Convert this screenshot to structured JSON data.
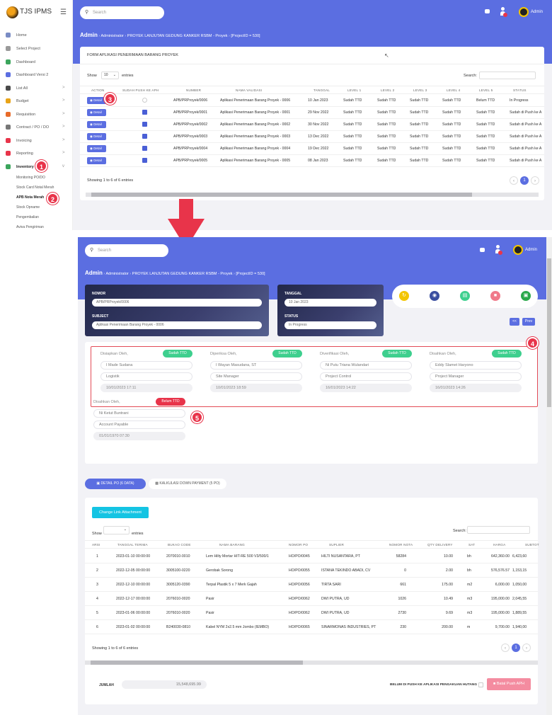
{
  "app": {
    "name": "TJS IPMS"
  },
  "sidebar": {
    "items": [
      {
        "label": "Home",
        "color": "#7a8cc4",
        "chev": ""
      },
      {
        "label": "Select Project",
        "color": "#9a9a9a",
        "chev": ""
      },
      {
        "label": "Dashboard",
        "color": "#3ba55c",
        "chev": ""
      },
      {
        "label": "Dashboard Versi 2",
        "color": "#5b6ee1",
        "chev": ""
      },
      {
        "label": "List All",
        "color": "#4a4a4a",
        "chev": ">"
      },
      {
        "label": "Budget",
        "color": "#e8a317",
        "chev": ">"
      },
      {
        "label": "Requisition",
        "color": "#e86b2a",
        "chev": ">"
      },
      {
        "label": "Contract / PO / DO",
        "color": "#777",
        "chev": ">"
      },
      {
        "label": "Invoicing",
        "color": "#e8344a",
        "chev": ">"
      },
      {
        "label": "Reporting",
        "color": "#e8344a",
        "chev": ">"
      },
      {
        "label": "Inventory",
        "color": "#3ba55c",
        "chev": "v"
      }
    ],
    "sub": [
      "Monitoring PO/DO",
      "Stock Card Notal Merah",
      "APB Nota Merah",
      "Stock Opname",
      "Pengembalian",
      "Aviva Pengiriman"
    ]
  },
  "header": {
    "search_placeholder": "Search",
    "user": "Admin"
  },
  "breadcrumb": {
    "title": "Admin",
    "items": [
      "Administrator",
      "PROYEK LANJUTAN GEDUNG KANKER RSBM - Proyek",
      "[ProjectID = 530]"
    ]
  },
  "list": {
    "title": "FORM APLIKASI PENERIMAAN BARANG PROYEK",
    "show_label": "Show",
    "show_value": "10",
    "entries_label": "entries",
    "search_label": "Search:",
    "columns": [
      "ACTION",
      "SUDAH PUSH KE APH",
      "NUMBER",
      "NAMA VALIDASI",
      "TANGGAL",
      "LEVEL 1",
      "LEVEL 2",
      "LEVEL 3",
      "LEVEL 4",
      "LEVEL 5",
      "STATUS"
    ],
    "detail_label": "Detail",
    "rows": [
      {
        "number": "APB/PRProyek/0006",
        "nama": "Aplikasi Penerimaan Barang Proyek - 0006",
        "tanggal": "10 Jan 2023",
        "l1": "Sudah TTD",
        "l2": "Sudah TTD",
        "l3": "Sudah TTD",
        "l4": "Sudah TTD",
        "l5": "Belum TTD",
        "status": "In Progress",
        "pushed": false
      },
      {
        "number": "APB/PRProyek/0001",
        "nama": "Aplikasi Penerimaan Barang Proyek - 0001",
        "tanggal": "29 Nov 2022",
        "l1": "Sudah TTD",
        "l2": "Sudah TTD",
        "l3": "Sudah TTD",
        "l4": "Sudah TTD",
        "l5": "Sudah TTD",
        "status": "Sudah di Push ke A",
        "pushed": true
      },
      {
        "number": "APB/PRProyek/0002",
        "nama": "Aplikasi Penerimaan Barang Proyek - 0002",
        "tanggal": "30 Nov 2022",
        "l1": "Sudah TTD",
        "l2": "Sudah TTD",
        "l3": "Sudah TTD",
        "l4": "Sudah TTD",
        "l5": "Sudah TTD",
        "status": "Sudah di Push ke A",
        "pushed": true
      },
      {
        "number": "APB/PRProyek/0003",
        "nama": "Aplikasi Penerimaan Barang Proyek - 0003",
        "tanggal": "13 Dec 2022",
        "l1": "Sudah TTD",
        "l2": "Sudah TTD",
        "l3": "Sudah TTD",
        "l4": "Sudah TTD",
        "l5": "Sudah TTD",
        "status": "Sudah di Push ke A",
        "pushed": true
      },
      {
        "number": "APB/PRProyek/0004",
        "nama": "Aplikasi Penerimaan Barang Proyek - 0004",
        "tanggal": "19 Dec 2022",
        "l1": "Sudah TTD",
        "l2": "Sudah TTD",
        "l3": "Sudah TTD",
        "l4": "Sudah TTD",
        "l5": "Sudah TTD",
        "status": "Sudah di Push ke A",
        "pushed": true
      },
      {
        "number": "APB/PRProyek/0005",
        "nama": "Aplikasi Penerimaan Barang Proyek - 0005",
        "tanggal": "08 Jan 2023",
        "l1": "Sudah TTD",
        "l2": "Sudah TTD",
        "l3": "Sudah TTD",
        "l4": "Sudah TTD",
        "l5": "Sudah TTD",
        "status": "Sudah di Push ke A",
        "pushed": true
      }
    ],
    "showing": "Showing 1 to 6 of 6 entries",
    "page": "1"
  },
  "detail": {
    "nomor_label": "NOMOR",
    "nomor": "APB/PRProyek/0006",
    "subject_label": "SUBJECT",
    "subject": "Aplikasi Penerimaan Barang Proyek - 0006",
    "tanggal_label": "TANGGAL",
    "tanggal": "10 Jan 2023",
    "status_label": "STATUS",
    "status": "In Progress",
    "back_label": "<<",
    "prev_label": "Prev",
    "signers": [
      {
        "role": "Disiapkan Oleh,",
        "badge": "Sudah TTD",
        "name": "I Made Sudana",
        "jabatan": "Logistik",
        "date": "10/01/2023 17:11"
      },
      {
        "role": "Diperiksa Oleh,",
        "badge": "Sudah TTD",
        "name": "I Wayan Masudana, ST",
        "jabatan": "Site Manager",
        "date": "10/01/2023 18:59"
      },
      {
        "role": "Diverifikasi Oleh,",
        "badge": "Sudah TTD",
        "name": "Ni Putu Triana Wulandari",
        "jabatan": "Project Control",
        "date": "16/01/2023 14:22"
      },
      {
        "role": "Disahkan Oleh,",
        "badge": "Sudah TTD",
        "name": "Eddy Slamet Haryono",
        "jabatan": "Project Manager",
        "date": "16/01/2023 14:26"
      },
      {
        "role": "Disahkan Oleh,",
        "badge": "Belum TTD",
        "name": "Ni Ketut Buntrani",
        "jabatan": "Account Payable",
        "date": "01/01/1970 07:30"
      }
    ],
    "tab1": "DETAIL PO (6 DATA)",
    "tab2": "KALKULASI DOWN PAYMENT (5 PO)",
    "change_btn": "Change Link Attachment",
    "show_label": "Show",
    "entries_label": "entries",
    "search_label": "Search:",
    "columns": [
      "ARSI",
      "TANGGAL TERIMA",
      "BUKAO CODE",
      "NAMA BARANG",
      "NOMOR PO",
      "SUPLIER",
      "NOMOR NOTA",
      "QTY DELIVERY",
      "SAT",
      "HARGA",
      "SUBTOT"
    ],
    "rows": [
      [
        "1",
        "2023-01-10 00:00:00",
        "2070010-0010",
        "Lem Hilty Mortar HIT-RE 500 V3/500/1",
        "HO/PO/0045",
        "HILTI NUSANTARA, PT",
        "58284",
        "10.00",
        "bh",
        "642,360.00",
        "6,423,60"
      ],
      [
        "2",
        "2022-12-05 00:00:00",
        "3005100-0220",
        "Gerobak Sorong",
        "HO/PO/0055",
        "ISTANA TEKINDO ABADI, CV",
        "0",
        "2.00",
        "bh",
        "576,576.57",
        "1,153,15"
      ],
      [
        "3",
        "2022-12-10 00:00:00",
        "3005120-0390",
        "Terpal Plastik 5 x 7 Merk Gajah",
        "HO/PO/0056",
        "TIRTA SARI",
        "661",
        "175.00",
        "m2",
        "6,000.00",
        "1,050,00"
      ],
      [
        "4",
        "2022-12-17 00:00:00",
        "2076010-0020",
        "Pasir",
        "HO/PO/0062",
        "DWI PUTRA, UD",
        "1026",
        "10.49",
        "m3",
        "195,000.00",
        "2,045,55"
      ],
      [
        "5",
        "2023-01-06 00:00:00",
        "2076010-0020",
        "Pasir",
        "HO/PO/0062",
        "DWI PUTRA, UD",
        "2730",
        "9.69",
        "m3",
        "195,000.00",
        "1,889,55"
      ],
      [
        "6",
        "2023-01-02 00:00:00",
        "B240030-0810",
        "Kabel NYM 2x2.5 mm Jombo (IEMBO)",
        "HO/PO/0065",
        "SINARMONAS INDUSTRIES, PT",
        "230",
        "200.00",
        "m",
        "9,700.00",
        "1,940,00"
      ]
    ],
    "showing": "Showing 1 to 6 of 6 entries",
    "page": "1",
    "jumlah_label": "JUMLAH",
    "jumlah": "15,548,695.99",
    "push_label": "BELUM DI PUSH KE APLIKASI PENGAKUAN HUTANG",
    "batal_btn": "Batal Push APH"
  },
  "annotations": [
    "1",
    "2",
    "3",
    "4",
    "5"
  ],
  "colors": {
    "primary": "#5b6ee1",
    "success": "#3ecf8e",
    "danger": "#e8344a",
    "annotation": "#e8344a"
  }
}
